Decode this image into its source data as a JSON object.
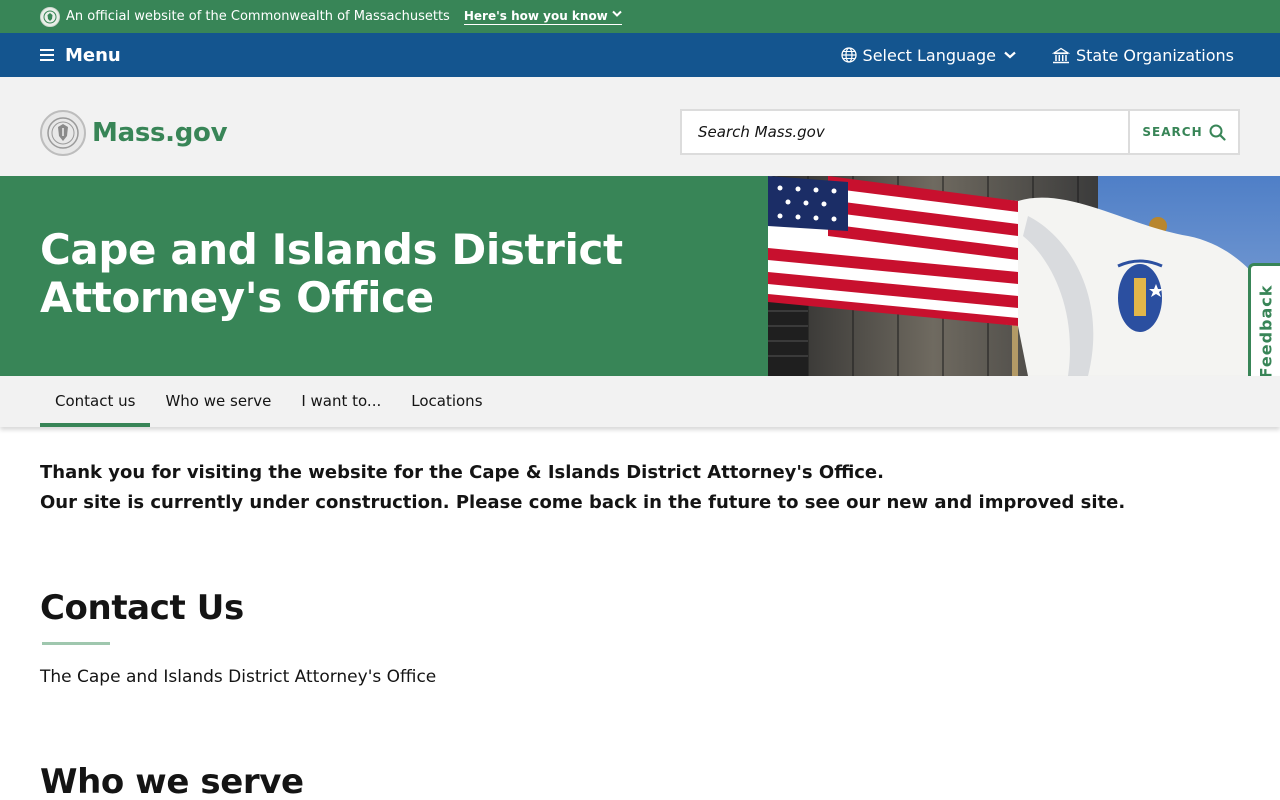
{
  "official_bar": {
    "text": "An official website of the Commonwealth of Massachusetts",
    "how_know": "Here's how you know",
    "icon": "seal-icon"
  },
  "utility_nav": {
    "menu_label": "Menu",
    "language_label": "Select Language",
    "state_orgs_label": "State Organizations"
  },
  "header": {
    "brand": "Mass.gov",
    "search": {
      "placeholder": "Search Mass.gov",
      "button_label": "SEARCH"
    }
  },
  "hero": {
    "title": "Cape and Islands District Attorney's Office"
  },
  "feedback_label": "Feedback",
  "page_nav": {
    "tabs": [
      {
        "label": "Contact us",
        "active": true
      },
      {
        "label": "Who we serve",
        "active": false
      },
      {
        "label": "I want to...",
        "active": false
      },
      {
        "label": "Locations",
        "active": false
      }
    ]
  },
  "content": {
    "intro_line1": "Thank you for visiting the website for the Cape & Islands District Attorney's Office.",
    "intro_line2": "Our site is currently under construction. Please come back in the future to see our new and improved site.",
    "contact_heading": "Contact Us",
    "contact_text": "The Cape and Islands District Attorney's Office",
    "who_heading": "Who we serve"
  },
  "colors": {
    "green": "#388557",
    "blue": "#14558f",
    "light_gray": "#f2f2f2"
  }
}
